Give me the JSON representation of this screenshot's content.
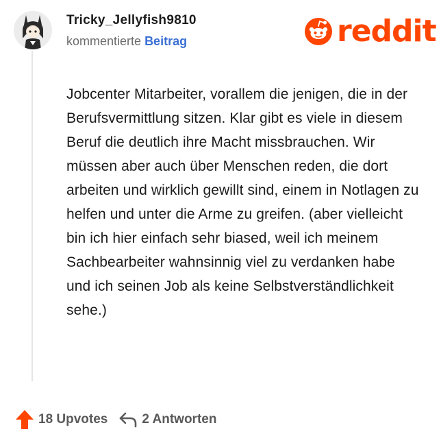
{
  "comment": {
    "username": "Tricky_Jellyfish9810",
    "action_text": "kommentierte",
    "action_link": "Beitrag",
    "body": "Jobcenter Mitarbeiter, vorallem die jenigen, die in der Berufsvermittlung sitzen. Klar gibt es viele in diesem Beruf die deutlich ihre Macht missbrauchen. Wir müssen aber auch über Menschen reden, die dort arbeiten und wirklich gewillt sind, einem in Notlagen zu helfen und unter die Arme zu greifen. (aber vielleicht bin ich hier einfach sehr biased, weil ich meinem Sachbearbeiter wahnsinnig viel zu verdanken habe und ich seinen Job als keine Selbstverständlichkeit sehe.)",
    "upvotes_label": "18 Upvotes",
    "replies_label": "2 Antworten"
  },
  "brand": {
    "name": "reddit",
    "color": "#ff4500"
  },
  "icons": {
    "upvote": "upvote-arrow-icon",
    "reply": "reply-arrow-icon",
    "logo": "reddit-snoo-icon"
  }
}
